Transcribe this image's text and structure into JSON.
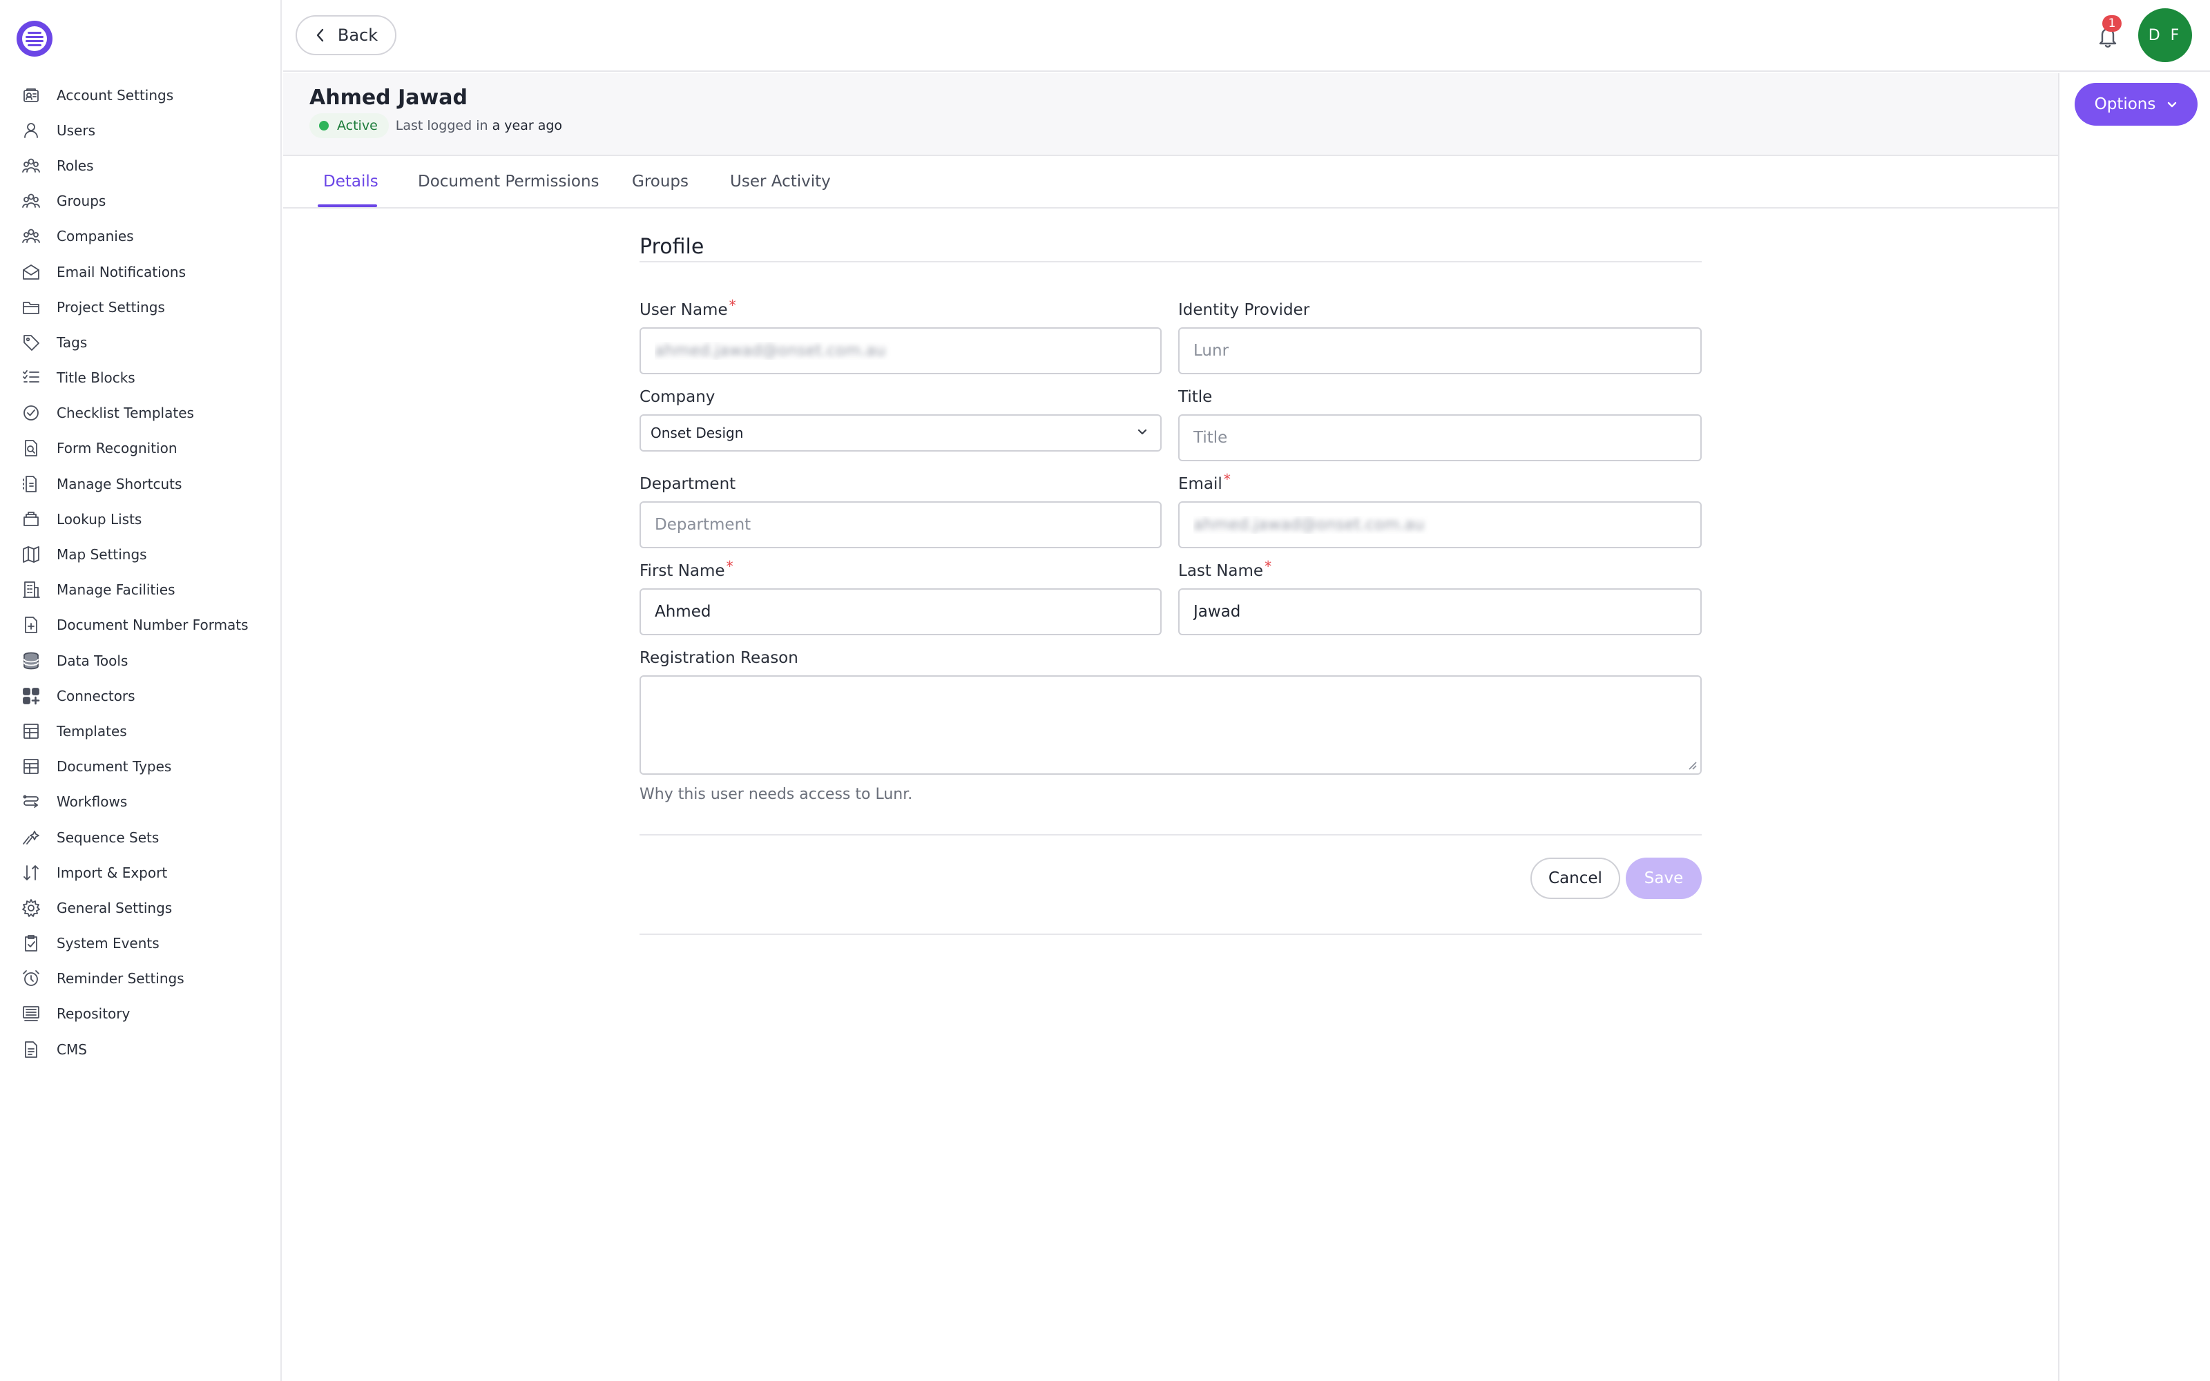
{
  "sidebar": {
    "items": [
      {
        "label": "Account Settings",
        "icon": "account-settings-icon"
      },
      {
        "label": "Users",
        "icon": "users-icon"
      },
      {
        "label": "Roles",
        "icon": "roles-icon"
      },
      {
        "label": "Groups",
        "icon": "groups-icon"
      },
      {
        "label": "Companies",
        "icon": "companies-icon"
      },
      {
        "label": "Email Notifications",
        "icon": "email-icon"
      },
      {
        "label": "Project Settings",
        "icon": "folder-icon"
      },
      {
        "label": "Tags",
        "icon": "tag-icon"
      },
      {
        "label": "Title Blocks",
        "icon": "list-check-icon"
      },
      {
        "label": "Checklist Templates",
        "icon": "check-circle-icon"
      },
      {
        "label": "Form Recognition",
        "icon": "document-search-icon"
      },
      {
        "label": "Manage Shortcuts",
        "icon": "shortcut-icon"
      },
      {
        "label": "Lookup Lists",
        "icon": "stack-icon"
      },
      {
        "label": "Map Settings",
        "icon": "map-icon"
      },
      {
        "label": "Manage Facilities",
        "icon": "building-icon"
      },
      {
        "label": "Document Number Formats",
        "icon": "document-plus-icon"
      },
      {
        "label": "Data Tools",
        "icon": "database-icon"
      },
      {
        "label": "Connectors",
        "icon": "grid-plus-icon"
      },
      {
        "label": "Templates",
        "icon": "template-icon"
      },
      {
        "label": "Document Types",
        "icon": "document-types-icon"
      },
      {
        "label": "Workflows",
        "icon": "workflow-icon"
      },
      {
        "label": "Sequence Sets",
        "icon": "sequence-icon"
      },
      {
        "label": "Import & Export",
        "icon": "import-export-icon"
      },
      {
        "label": "General Settings",
        "icon": "gear-icon"
      },
      {
        "label": "System Events",
        "icon": "clipboard-check-icon"
      },
      {
        "label": "Reminder Settings",
        "icon": "alarm-clock-icon"
      },
      {
        "label": "Repository",
        "icon": "repository-icon"
      },
      {
        "label": "CMS",
        "icon": "document-icon"
      }
    ]
  },
  "topbar": {
    "back_label": "Back",
    "notification_count": "1",
    "avatar_initials": "D F"
  },
  "header": {
    "user_name": "Ahmed Jawad",
    "status": "Active",
    "login_prefix": "Last logged in",
    "login_time": "a year ago",
    "options_label": "Options"
  },
  "tabs": [
    {
      "label": "Details",
      "active": true
    },
    {
      "label": "Document Permissions",
      "active": false
    },
    {
      "label": "Groups",
      "active": false
    },
    {
      "label": "User Activity",
      "active": false
    }
  ],
  "form": {
    "section_title": "Profile",
    "username": {
      "label": "User Name",
      "value": "ahmed.jawad@onset.com.au"
    },
    "identity_provider": {
      "label": "Identity Provider",
      "placeholder": "Lunr"
    },
    "company": {
      "label": "Company",
      "value": "Onset Design"
    },
    "title": {
      "label": "Title",
      "placeholder": "Title"
    },
    "department": {
      "label": "Department",
      "placeholder": "Department"
    },
    "email": {
      "label": "Email",
      "value": "ahmed.jawad@onset.com.au"
    },
    "first_name": {
      "label": "First Name",
      "value": "Ahmed"
    },
    "last_name": {
      "label": "Last Name",
      "value": "Jawad"
    },
    "registration_reason": {
      "label": "Registration Reason",
      "help": "Why this user needs access to Lunr."
    },
    "required_mark": "*",
    "cancel_label": "Cancel",
    "save_label": "Save"
  },
  "colors": {
    "accent": "#6b46e6",
    "options_button": "#7b52f0",
    "save_disabled": "#c6b6f8",
    "avatar": "#1b8a3c",
    "active_status": "#2fb45a",
    "badge": "#e5484d",
    "required": "#e5484d"
  }
}
